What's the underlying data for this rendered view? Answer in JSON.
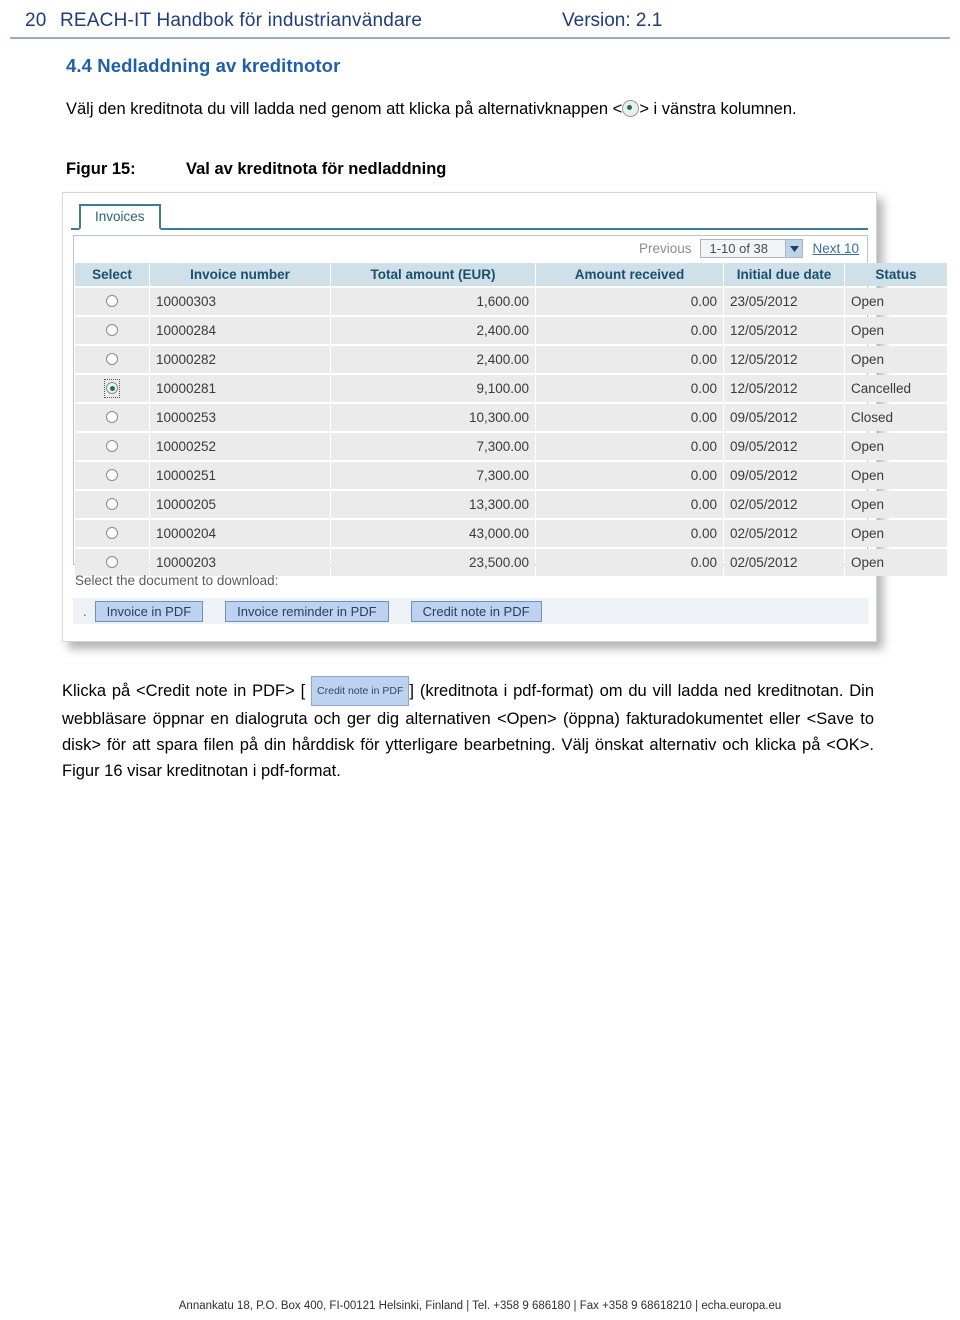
{
  "header": {
    "page_number": "20",
    "title": "REACH-IT Handbok för industrianvändare",
    "version": "Version: 2.1"
  },
  "section": {
    "title": "4.4 Nedladdning av kreditnotor",
    "intro_before_icon": "Välj den kreditnota du vill ladda ned genom att klicka på alternativknappen <",
    "intro_after_icon": "> i vänstra kolumnen.",
    "radio_icon_name": "radio-button-icon"
  },
  "figure": {
    "label": "Figur 15:",
    "caption": "Val av kreditnota för nedladdning"
  },
  "screenshot": {
    "tab_label": "Invoices",
    "pager": {
      "previous_label": "Previous",
      "range_value": "1-10 of 38",
      "next_label": "Next 10"
    },
    "columns": [
      "Select",
      "Invoice number",
      "Total amount (EUR)",
      "Amount received",
      "Initial due date",
      "Status"
    ],
    "rows": [
      {
        "selected": false,
        "invoice_number": "10000303",
        "total_amount": "1,600.00",
        "amount_received": "0.00",
        "initial_due_date": "23/05/2012",
        "status": "Open"
      },
      {
        "selected": false,
        "invoice_number": "10000284",
        "total_amount": "2,400.00",
        "amount_received": "0.00",
        "initial_due_date": "12/05/2012",
        "status": "Open"
      },
      {
        "selected": false,
        "invoice_number": "10000282",
        "total_amount": "2,400.00",
        "amount_received": "0.00",
        "initial_due_date": "12/05/2012",
        "status": "Open"
      },
      {
        "selected": true,
        "invoice_number": "10000281",
        "total_amount": "9,100.00",
        "amount_received": "0.00",
        "initial_due_date": "12/05/2012",
        "status": "Cancelled"
      },
      {
        "selected": false,
        "invoice_number": "10000253",
        "total_amount": "10,300.00",
        "amount_received": "0.00",
        "initial_due_date": "09/05/2012",
        "status": "Closed"
      },
      {
        "selected": false,
        "invoice_number": "10000252",
        "total_amount": "7,300.00",
        "amount_received": "0.00",
        "initial_due_date": "09/05/2012",
        "status": "Open"
      },
      {
        "selected": false,
        "invoice_number": "10000251",
        "total_amount": "7,300.00",
        "amount_received": "0.00",
        "initial_due_date": "09/05/2012",
        "status": "Open"
      },
      {
        "selected": false,
        "invoice_number": "10000205",
        "total_amount": "13,300.00",
        "amount_received": "0.00",
        "initial_due_date": "02/05/2012",
        "status": "Open"
      },
      {
        "selected": false,
        "invoice_number": "10000204",
        "total_amount": "43,000.00",
        "amount_received": "0.00",
        "initial_due_date": "02/05/2012",
        "status": "Open"
      },
      {
        "selected": false,
        "invoice_number": "10000203",
        "total_amount": "23,500.00",
        "amount_received": "0.00",
        "initial_due_date": "02/05/2012",
        "status": "Open"
      }
    ],
    "download_label": "Select the document to download:",
    "dot_mark": ".",
    "buttons": [
      "Invoice in PDF",
      "Invoice reminder in PDF",
      "Credit note in PDF"
    ]
  },
  "body_paragraph": {
    "part1": "Klicka på <Credit note in PDF> [",
    "inline_button_label": "Credit note in PDF",
    "part2": "] (kreditnota i pdf-format) om du vill ladda ned kreditnotan. Din webbläsare öppnar en dialogruta och ger dig alternativen <Open> (öppna) fakturadokumentet eller <Save to disk> för att spara filen på din hårddisk för ytterligare bearbetning. Välj önskat alternativ och klicka på <OK>. Figur 16 visar kreditnotan i pdf-format."
  },
  "footer": {
    "text": "Annankatu 18, P.O. Box 400, FI-00121 Helsinki, Finland | Tel. +358 9 686180 | Fax +358 9 68618210 | echa.europa.eu"
  },
  "colors": {
    "header_blue": "#1f3d7a",
    "section_blue": "#1f5fa9",
    "table_header_bg": "#cfe0e8",
    "row_bg": "#ebebeb",
    "button_bg": "#bcd2ee",
    "radio_green": "#1d7a32"
  }
}
